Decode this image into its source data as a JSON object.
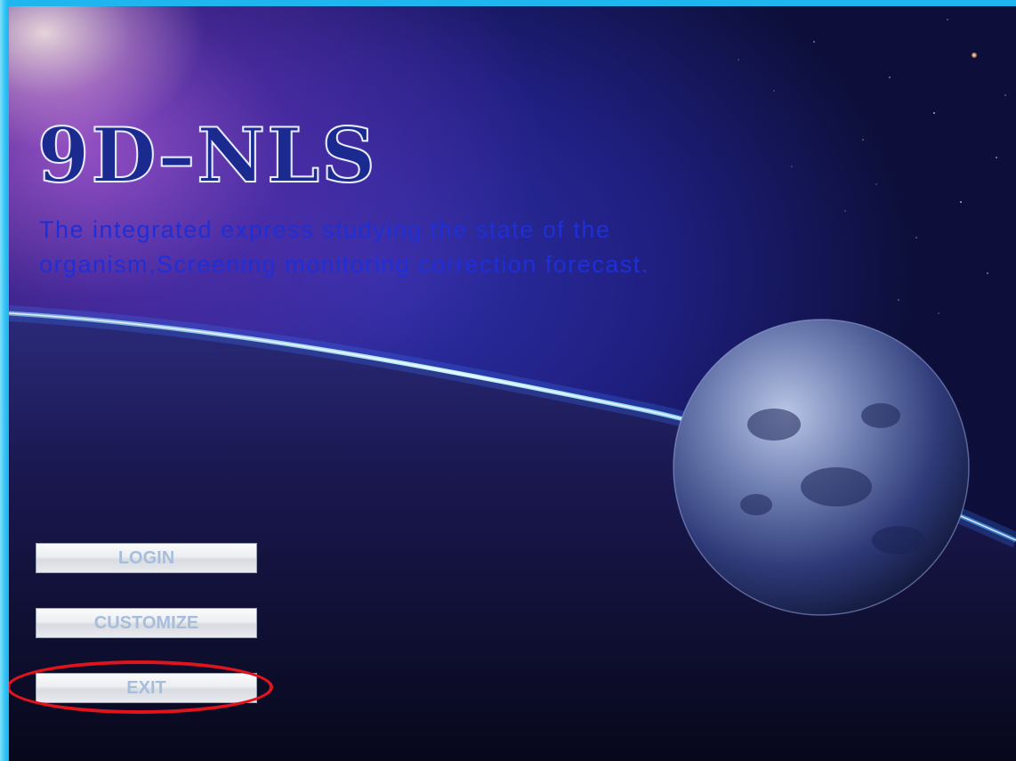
{
  "app": {
    "title": "9D–NLS",
    "subtitle": "The integrated express studying the state of the organism,Screening monitoring correction forecast."
  },
  "buttons": {
    "login_label": "LOGIN",
    "customize_label": "CUSTOMIZE",
    "exit_label": "EXIT"
  },
  "colors": {
    "title_fill": "#1a2a8f",
    "subtitle_text": "#1e2fd8",
    "button_text": "#a6bedc",
    "highlight_ring": "#e0141c",
    "frame": "#1fb5ee"
  }
}
